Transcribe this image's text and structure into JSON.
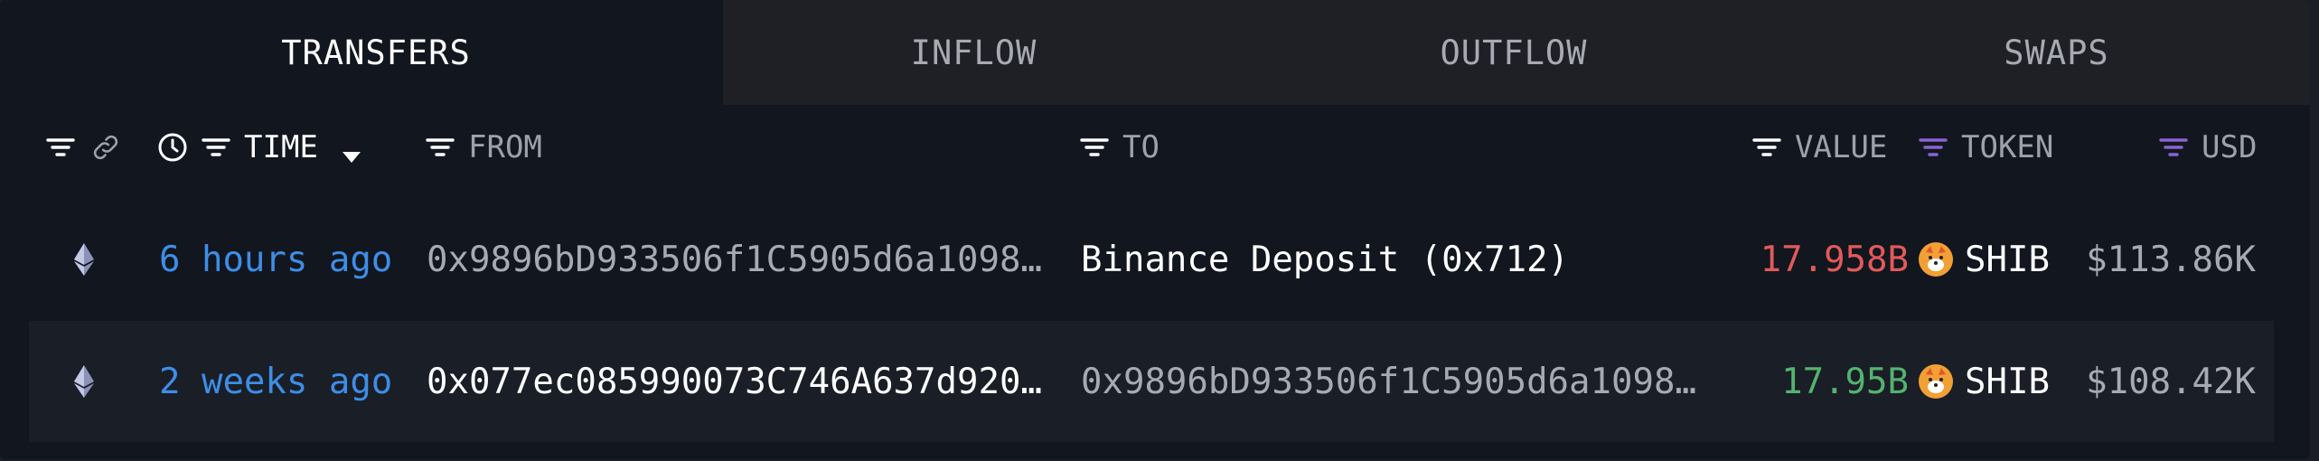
{
  "tabs": [
    {
      "label": "TRANSFERS"
    },
    {
      "label": "INFLOW"
    },
    {
      "label": "OUTFLOW"
    },
    {
      "label": "SWAPS"
    }
  ],
  "header": {
    "time": "TIME",
    "from": "FROM",
    "to": "TO",
    "value": "VALUE",
    "token": "TOKEN",
    "usd": "USD"
  },
  "rows": [
    {
      "chain_icon": "ethereum-icon",
      "time": "6 hours ago",
      "from": "0x9896bD933506f1C5905d6a1098…",
      "to": "Binance Deposit (0x712)",
      "value": "17.958B",
      "token_icon": "shib-icon",
      "token": "SHIB",
      "usd": "$113.86K"
    },
    {
      "chain_icon": "ethereum-icon",
      "time": "2 weeks ago",
      "from": "0x077ec085990073C746A637d920…",
      "to": "0x9896bD933506f1C5905d6a1098…",
      "value": "17.95B",
      "token_icon": "shib-icon",
      "token": "SHIB",
      "usd": "$108.42K"
    }
  ],
  "colors": {
    "accent_blue": "#3d8ee6",
    "outflow_red": "#e25a5a",
    "inflow_green": "#54b36e",
    "token_filter_purple": "#8a63d2",
    "panel_bg": "#12161f"
  }
}
